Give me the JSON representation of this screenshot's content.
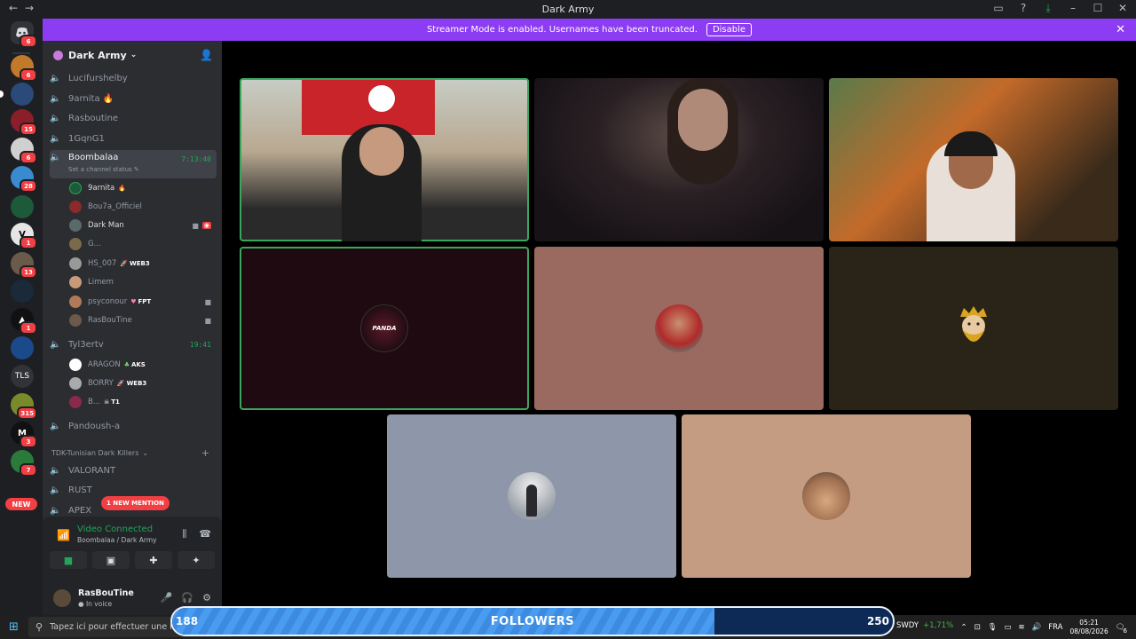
{
  "window": {
    "title": "Dark Army"
  },
  "banner": {
    "message": "Streamer Mode is enabled. Usernames have been truncated.",
    "button": "Disable"
  },
  "rail": {
    "badges": [
      "6",
      "6",
      "15",
      "6",
      "28",
      "1",
      "13",
      "1",
      "315",
      "3",
      "7"
    ],
    "text_server": "TLS",
    "new_label": "NEW"
  },
  "guild": {
    "name": "Dark Army"
  },
  "channels": {
    "c1": "Lucifurshelby",
    "c2": "9arnita 🔥",
    "c3": "Rasboutine",
    "c4": "1GqnG1",
    "active": {
      "name": "Boombalaa",
      "status": "Set a channel status ✎",
      "timer": "7:13:40",
      "users": [
        {
          "name": "9arnita",
          "tag": "🔥"
        },
        {
          "name": "Bou7a_Officiel",
          "tag": ""
        },
        {
          "name": "Dark Man",
          "tag": ""
        },
        {
          "name": "G...",
          "tag": ""
        },
        {
          "name": "HS_007",
          "tag": "WEB3"
        },
        {
          "name": "Limem",
          "tag": ""
        },
        {
          "name": "psyconour",
          "tag": "FPT"
        },
        {
          "name": "RasBouTine",
          "tag": ""
        }
      ]
    },
    "second": {
      "name": "Tyl3ertv",
      "timer": "19:41",
      "users": [
        {
          "name": "ARAGON",
          "tag": "AKS"
        },
        {
          "name": "BORRY",
          "tag": "WEB3"
        },
        {
          "name": "B...",
          "tag": "T1"
        }
      ]
    },
    "c5": "Pandoush-a",
    "category": "TDK-Tunisian Dark Killers",
    "v1": "VALORANT",
    "v2": "RUST",
    "v3": "APEX",
    "mention_pill": "1 NEW MENTION"
  },
  "voice": {
    "title": "Video Connected",
    "subtitle": "Boombalaa / Dark Army"
  },
  "me": {
    "name": "RasBouTine",
    "status": "In voice"
  },
  "taskbar": {
    "search_placeholder": "Tapez ici pour effectuer une re",
    "ticker_symbol": "SWDY",
    "ticker_change": "+1,71%",
    "lang": "FRA",
    "time": "05:21",
    "date": "08/08/2026",
    "notif": "6"
  },
  "followers": {
    "label": "FOLLOWERS",
    "current": "188",
    "goal": "250",
    "current_value": 188,
    "goal_value": 250,
    "colors": {
      "fill": "#4a9cf0",
      "bg": "#0d2a57"
    }
  },
  "colors": {
    "accent_green": "#23a559",
    "banner": "#8c3cf2",
    "danger": "#f23f43"
  }
}
